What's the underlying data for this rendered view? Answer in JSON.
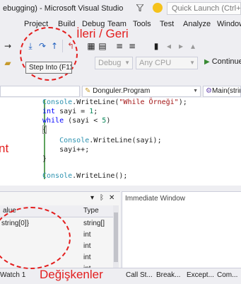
{
  "window": {
    "title": "ebugging) - Microsoft Visual Studio",
    "quick_launch_placeholder": "Quick Launch (Ctrl+Q)"
  },
  "menu": [
    "Project",
    "Build",
    "Debug",
    "Team",
    "Tools",
    "Test",
    "Analyze",
    "Window"
  ],
  "toolbar": {
    "icons": [
      "step-over-icon",
      "step-into-icon",
      "step-out-icon",
      "step-back-icon",
      "hex-icon",
      "breakpoint-icon"
    ],
    "config_combo": "Debug",
    "platform_combo": "Any CPU",
    "continue_label": "Continue",
    "tooltip": "Step Into (F11)"
  },
  "navbar": {
    "class_combo": "Donguler.Program",
    "member_combo": "Main(string[] ar"
  },
  "editor": {
    "lines": [
      {
        "tokens": [
          [
            "ty",
            "Console"
          ],
          [
            "p",
            "."
          ],
          [
            "p",
            "WriteLine("
          ],
          [
            "st",
            "\"While Örneği\""
          ],
          [
            "p",
            ");"
          ]
        ]
      },
      {
        "tokens": [
          [
            "kw",
            "int"
          ],
          [
            "p",
            " sayi = "
          ],
          [
            "nm",
            "1"
          ],
          [
            "p",
            ";"
          ]
        ]
      },
      {
        "tokens": [
          [
            "kw",
            "while"
          ],
          [
            "p",
            " (sayi < "
          ],
          [
            "nm",
            "5"
          ],
          [
            "p",
            ")"
          ]
        ]
      },
      {
        "tokens": [
          [
            "p",
            "{"
          ]
        ]
      },
      {
        "tokens": [
          [
            "p",
            "    "
          ],
          [
            "ty",
            "Console"
          ],
          [
            "p",
            ".WriteLine(sayi);"
          ]
        ]
      },
      {
        "tokens": [
          [
            "p",
            "    sayi++;"
          ]
        ]
      },
      {
        "tokens": [
          [
            "p",
            "}"
          ]
        ]
      },
      {
        "tokens": [
          [
            "p",
            ""
          ]
        ]
      },
      {
        "tokens": [
          [
            "ty",
            "Console"
          ],
          [
            "p",
            ".WriteLine();"
          ]
        ]
      }
    ]
  },
  "locals": {
    "col_value": "alue",
    "col_type": "Type",
    "rows": [
      {
        "value": "string[0]}",
        "type": "string[]"
      },
      {
        "value": "",
        "type": "int"
      },
      {
        "value": "",
        "type": "int"
      },
      {
        "value": "",
        "type": "int"
      },
      {
        "value": "",
        "type": "int"
      }
    ]
  },
  "immediate": {
    "title": "Immediate Window"
  },
  "bottom_tabs": [
    "Watch 1",
    "Call St...",
    "Break...",
    "Except...",
    "Com..."
  ],
  "annotations": {
    "ileri_geri": "İleri / Geri",
    "degiskenler": "Değişkenler",
    "left_text": "nt"
  }
}
